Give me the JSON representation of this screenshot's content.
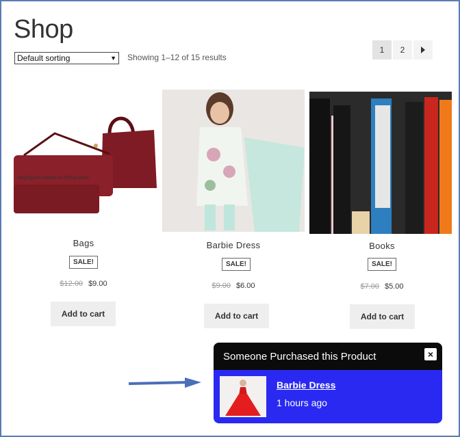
{
  "page": {
    "title": "Shop"
  },
  "toolbar": {
    "sort_value": "Default sorting",
    "results_text": "Showing 1–12 of 15 results"
  },
  "pagination": {
    "pages": [
      "1",
      "2"
    ],
    "current": "1",
    "next_icon": "arrow-right-icon"
  },
  "products": [
    {
      "name": "Bags",
      "badge": "SALE!",
      "old_price": "$12.00",
      "price": "$9.00",
      "cta": "Add to cart",
      "watermark": "lanjing.en.made-in-china.com"
    },
    {
      "name": "Barbie Dress",
      "badge": "SALE!",
      "old_price": "$9.00",
      "price": "$6.00",
      "cta": "Add to cart"
    },
    {
      "name": "Books",
      "badge": "SALE!",
      "old_price": "$7.00",
      "price": "$5.00",
      "cta": "Add to cart"
    }
  ],
  "popup": {
    "heading": "Someone Purchased this Product",
    "close_label": "×",
    "product_name": "Barbie Dress",
    "time_ago": "1 hours ago",
    "bg_color": "#2a29f2",
    "head_color": "#0b0b0b"
  },
  "colors": {
    "frame": "#5a7bb5",
    "arrow": "#4a6fb8"
  }
}
